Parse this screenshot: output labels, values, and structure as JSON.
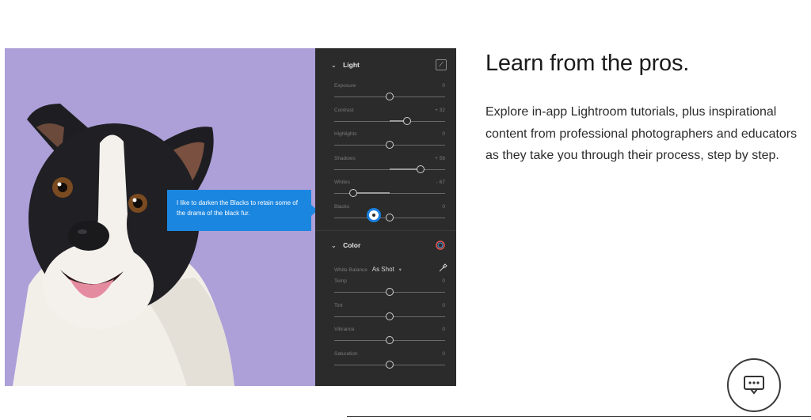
{
  "hero": {
    "tooltip_text": "I like to darken the Blacks to retain some of the drama of the black fur."
  },
  "panel": {
    "light_section": {
      "title": "Light",
      "sliders": [
        {
          "label": "Exposure",
          "value": "0",
          "level": 0.5
        },
        {
          "label": "Contrast",
          "value": "+ 32",
          "level": 0.66
        },
        {
          "label": "Highlights",
          "value": "0",
          "level": 0.5
        },
        {
          "label": "Shadows",
          "value": "+ 56",
          "level": 0.78
        },
        {
          "label": "Whites",
          "value": "- 67",
          "level": 0.17
        },
        {
          "label": "Blacks",
          "value": "0",
          "level": 0.5
        }
      ]
    },
    "color_section": {
      "title": "Color",
      "white_balance_label": "White Balance",
      "white_balance_value": "As Shot",
      "sliders": [
        {
          "label": "Temp",
          "value": "0",
          "level": 0.5
        },
        {
          "label": "Tint",
          "value": "0",
          "level": 0.5
        },
        {
          "label": "Vibrance",
          "value": "0",
          "level": 0.5
        },
        {
          "label": "Saturation",
          "value": "0",
          "level": 0.5
        }
      ]
    }
  },
  "content": {
    "heading": "Learn from the pros.",
    "body": "Explore in-app Lightroom tutorials, plus inspirational content from professional photographers and educators as they take you through their process, step by step."
  },
  "colors": {
    "accent": "#1b86e0",
    "panel_bg": "#2b2b2b",
    "photo_bg": "#ad9fd8"
  },
  "icons": [
    "chevron-down-icon",
    "tone-curve-icon",
    "color-wheel-icon",
    "eyedropper-icon",
    "chat-icon"
  ]
}
